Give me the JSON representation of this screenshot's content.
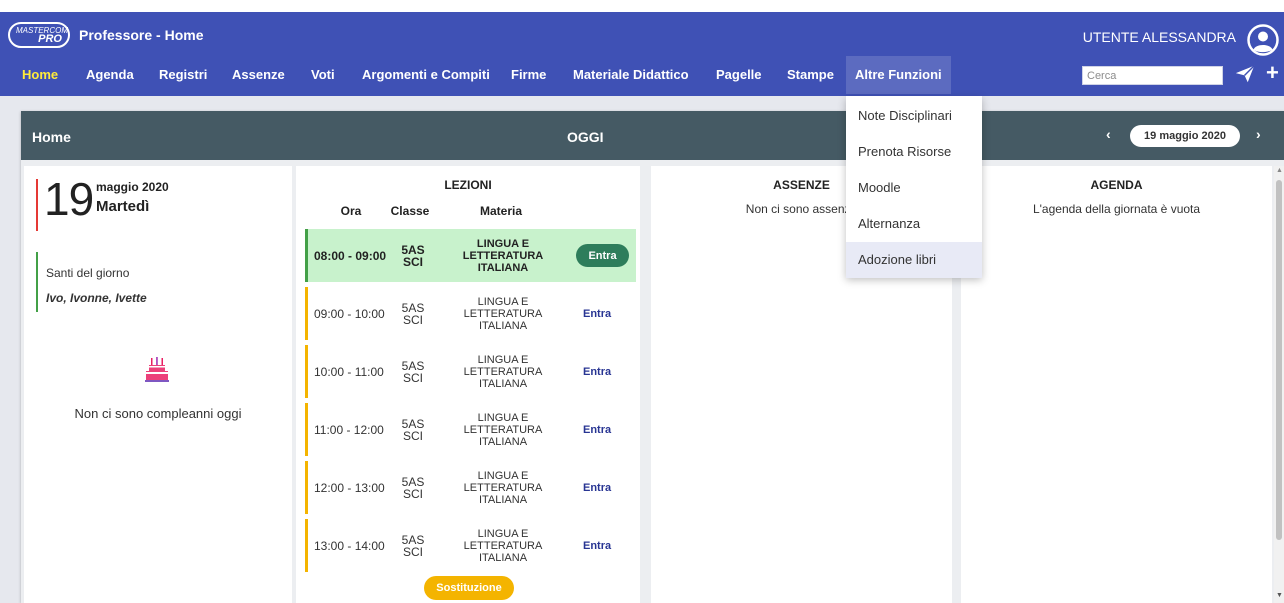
{
  "header": {
    "logo_top": "MASTERCOM",
    "logo_bottom": "PRO",
    "title": "Professore - Home",
    "user": "UTENTE ALESSANDRA"
  },
  "nav": {
    "items": [
      "Home",
      "Agenda",
      "Registri",
      "Assenze",
      "Voti",
      "Argomenti e Compiti",
      "Firme",
      "Materiale Didattico",
      "Pagelle",
      "Stampe",
      "Altre Funzioni"
    ],
    "search_placeholder": "Cerca"
  },
  "dropdown": {
    "items": [
      "Note Disciplinari",
      "Prenota Risorse",
      "Moodle",
      "Alternanza",
      "Adozione libri"
    ]
  },
  "card": {
    "title": "Home",
    "today": "OGGI",
    "date_prev": "‹",
    "date": "19 maggio 2020",
    "date_next": "›"
  },
  "day": {
    "number": "19",
    "month_year": "maggio 2020",
    "weekday": "Martedì",
    "santi_label": "Santi del giorno",
    "santi_names": "Ivo, Ivonne, Ivette",
    "birthday_msg": "Non ci sono compleanni oggi"
  },
  "lessons": {
    "title": "LEZIONI",
    "headers": [
      "Ora",
      "Classe",
      "Materia"
    ],
    "rows": [
      {
        "time": "08:00 - 09:00",
        "class": "5AS SCI",
        "subject": "LINGUA E LETTERATURA ITALIANA",
        "action": "Entra"
      },
      {
        "time": "09:00 - 10:00",
        "class": "5AS SCI",
        "subject": "LINGUA E LETTERATURA ITALIANA",
        "action": "Entra"
      },
      {
        "time": "10:00 - 11:00",
        "class": "5AS SCI",
        "subject": "LINGUA E LETTERATURA ITALIANA",
        "action": "Entra"
      },
      {
        "time": "11:00 - 12:00",
        "class": "5AS SCI",
        "subject": "LINGUA E LETTERATURA ITALIANA",
        "action": "Entra"
      },
      {
        "time": "12:00 - 13:00",
        "class": "5AS SCI",
        "subject": "LINGUA E LETTERATURA ITALIANA",
        "action": "Entra"
      },
      {
        "time": "13:00 - 14:00",
        "class": "5AS SCI",
        "subject": "LINGUA E LETTERATURA ITALIANA",
        "action": "Entra"
      }
    ],
    "substitution": "Sostituzione"
  },
  "absences": {
    "title": "ASSENZE",
    "message": "Non ci sono assenze"
  },
  "agenda": {
    "title": "AGENDA",
    "message": "L'agenda della giornata è vuota"
  },
  "colors": {
    "header": "#3f51b5",
    "card_head": "#455a64",
    "current_lesson": "#c8f2cc",
    "accent_yellow": "#f4b400",
    "enter_button": "#2e7d5b"
  }
}
